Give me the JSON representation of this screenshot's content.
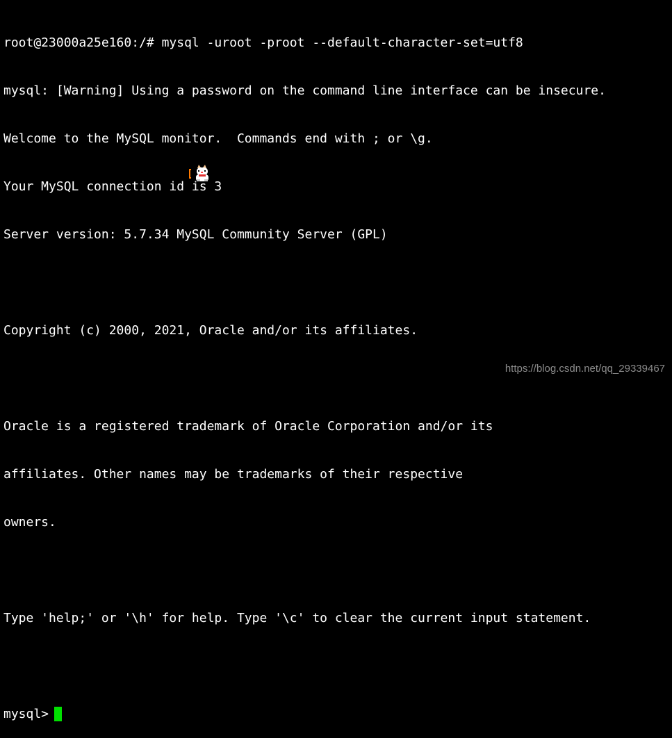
{
  "terminal": {
    "lines": [
      "root@23000a25e160:/# mysql -uroot -proot --default-character-set=utf8",
      "mysql: [Warning] Using a password on the command line interface can be insecure.",
      "Welcome to the MySQL monitor.  Commands end with ; or \\g.",
      "Your MySQL connection id is 3",
      "Server version: 5.7.34 MySQL Community Server (GPL)",
      "",
      "Copyright (c) 2000, 2021, Oracle and/or its affiliates.",
      "",
      "Oracle is a registered trademark of Oracle Corporation and/or its",
      "affiliates. Other names may be trademarks of their respective",
      "owners.",
      "",
      "Type 'help;' or '\\h' for help. Type '\\c' to clear the current input statement.",
      ""
    ],
    "prompt": "mysql>"
  },
  "watermark": "https://blog.csdn.net/qq_29339467",
  "colors": {
    "background": "#000000",
    "text": "#ffffff",
    "cursor": "#00e000",
    "watermark": "#8c8c8c"
  }
}
